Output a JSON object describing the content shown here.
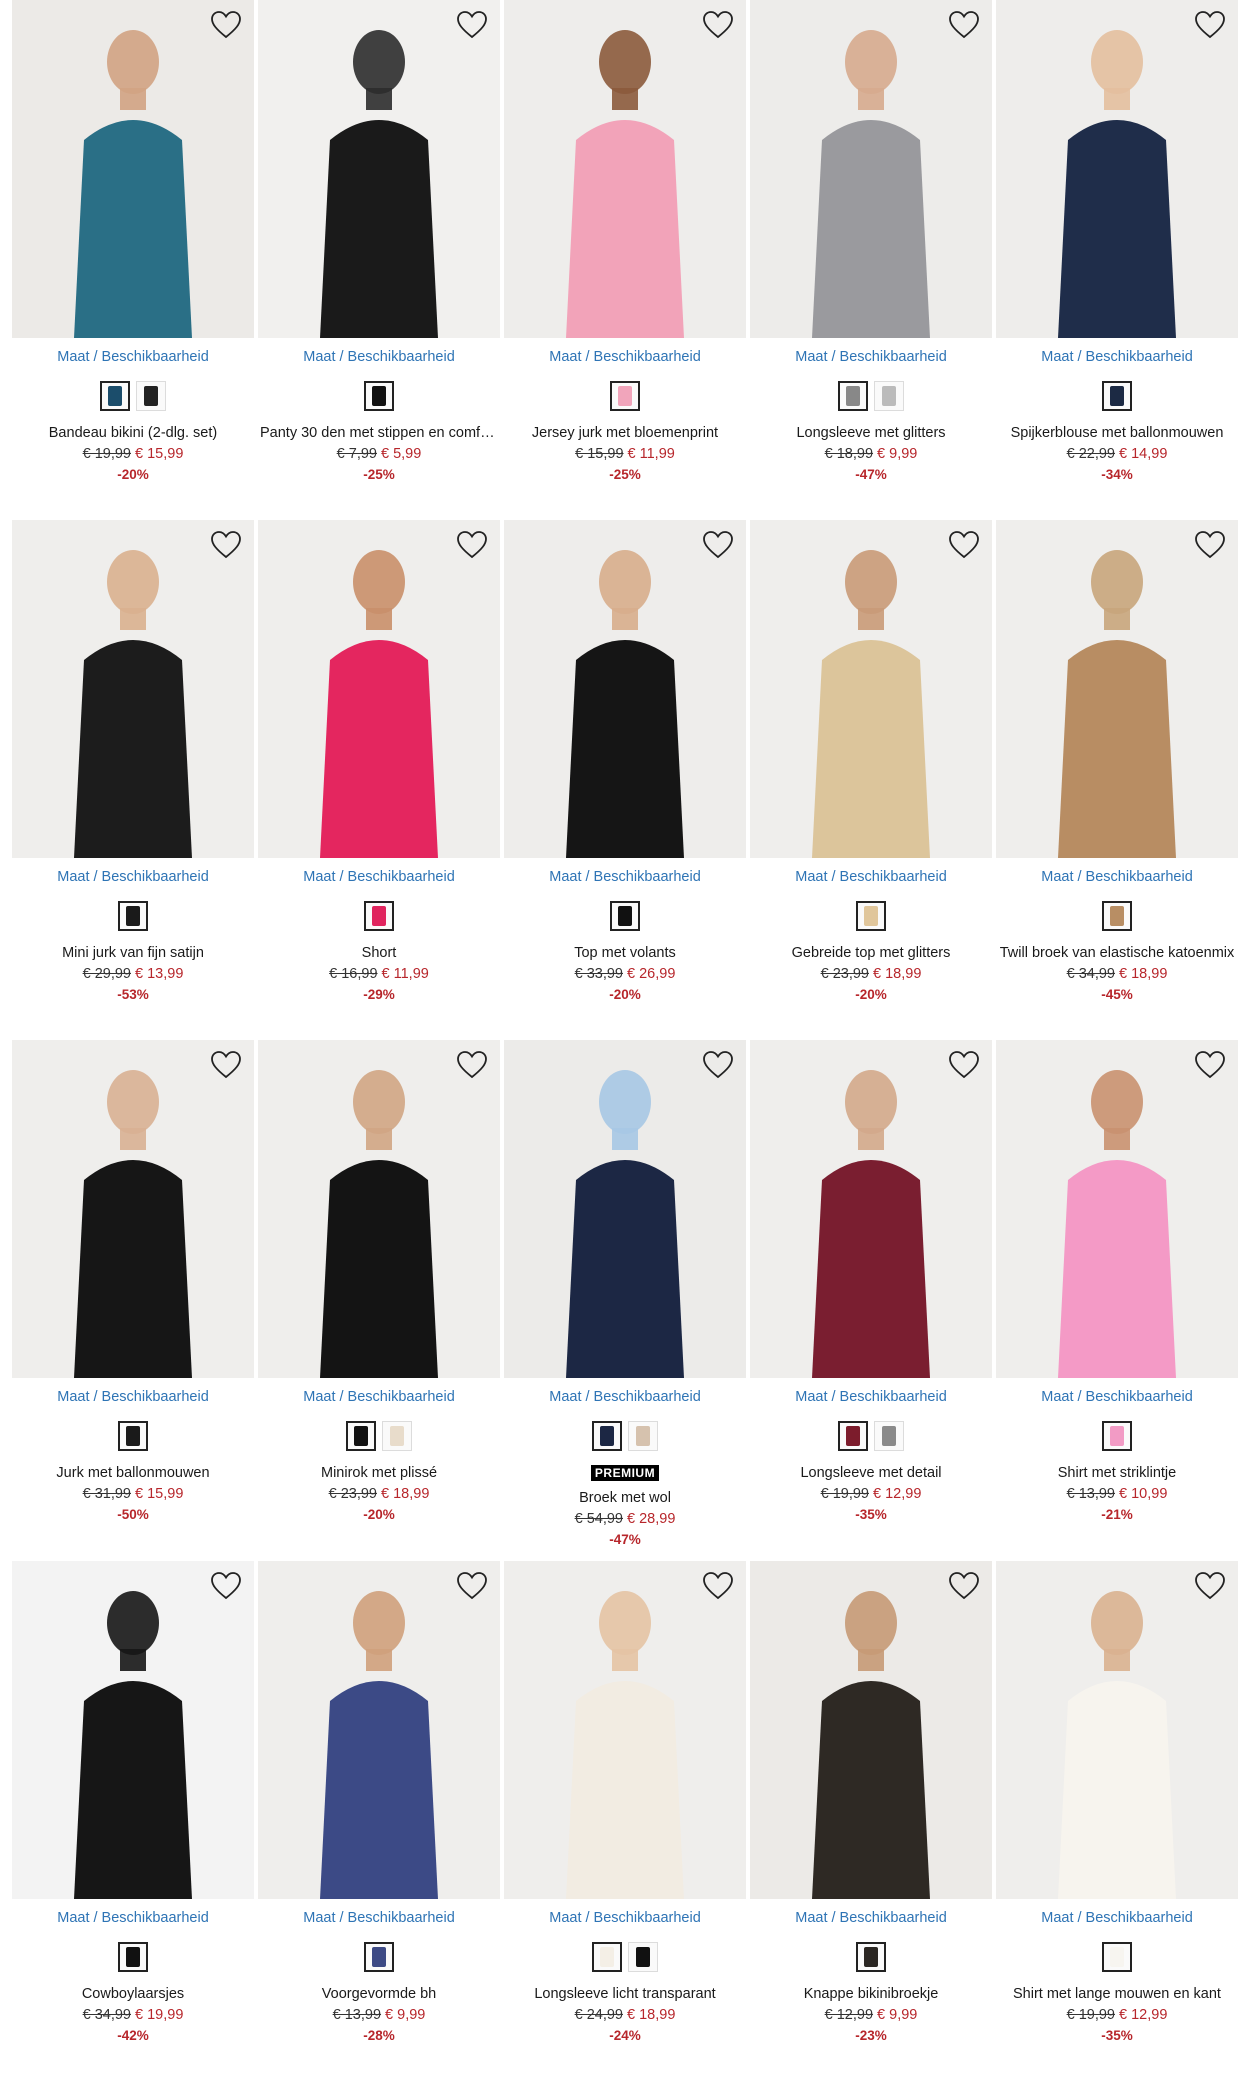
{
  "size_label": "Maat / Beschikbaarheid",
  "premium_label": "PREMIUM",
  "colors": {
    "sale": "#b7262b",
    "link": "#2e74b5"
  },
  "rows": [
    {
      "products": [
        {
          "name": "Bandeau bikini (2-dlg. set)",
          "old_price": "€ 19,99",
          "new_price": "€ 15,99",
          "discount": "-20%",
          "swatches": [
            "#1b4d6b",
            "#222222"
          ],
          "bg": "#eceae7",
          "fig": "#2a6f86",
          "skin": "#d2a383"
        },
        {
          "name": "Panty 30 den met stippen en comfo…",
          "old_price": "€ 7,99",
          "new_price": "€ 5,99",
          "discount": "-25%",
          "swatches": [
            "#111111"
          ],
          "bg": "#f1f0ee",
          "fig": "#1a1a1a",
          "skin": "#2c2c2c"
        },
        {
          "name": "Jersey jurk met bloemenprint",
          "old_price": "€ 15,99",
          "new_price": "€ 11,99",
          "discount": "-25%",
          "swatches": [
            "#f1a5bb"
          ],
          "bg": "#eeedeb",
          "fig": "#f2a3b9",
          "skin": "#8b5a3c"
        },
        {
          "name": "Longsleeve met glitters",
          "old_price": "€ 18,99",
          "new_price": "€ 9,99",
          "discount": "-47%",
          "swatches": [
            "#888888",
            "#bbbbbb"
          ],
          "bg": "#edecea",
          "fig": "#9a9a9e",
          "skin": "#d6ab8e"
        },
        {
          "name": "Spijkerblouse met ballonmouwen",
          "old_price": "€ 22,99",
          "new_price": "€ 14,99",
          "discount": "-34%",
          "swatches": [
            "#1c2a44"
          ],
          "bg": "#eeedeb",
          "fig": "#1f2d4a",
          "skin": "#e3bf9f"
        }
      ]
    },
    {
      "products": [
        {
          "name": "Mini jurk van fijn satijn",
          "old_price": "€ 29,99",
          "new_price": "€ 13,99",
          "discount": "-53%",
          "swatches": [
            "#1a1a1a"
          ],
          "bg": "#efeeec",
          "fig": "#1c1c1c",
          "skin": "#d9b08f"
        },
        {
          "name": "Short",
          "old_price": "€ 16,99",
          "new_price": "€ 11,99",
          "discount": "-29%",
          "swatches": [
            "#e0245e"
          ],
          "bg": "#efeeec",
          "fig": "#e4265f",
          "skin": "#c98f6a"
        },
        {
          "name": "Top met volants",
          "old_price": "€ 33,99",
          "new_price": "€ 26,99",
          "discount": "-20%",
          "swatches": [
            "#111111"
          ],
          "bg": "#eeedeb",
          "fig": "#151515",
          "skin": "#d7ad8c"
        },
        {
          "name": "Gebreide top met glitters",
          "old_price": "€ 23,99",
          "new_price": "€ 18,99",
          "discount": "-20%",
          "swatches": [
            "#e0c69b"
          ],
          "bg": "#efeeec",
          "fig": "#dcc59b",
          "skin": "#c99a78"
        },
        {
          "name": "Twill broek van elastische katoenmix",
          "old_price": "€ 34,99",
          "new_price": "€ 18,99",
          "discount": "-45%",
          "swatches": [
            "#b88e64"
          ],
          "bg": "#efeeec",
          "fig": "#b88d63",
          "skin": "#c8a57c"
        }
      ]
    },
    {
      "products": [
        {
          "name": "Jurk met ballonmouwen",
          "old_price": "€ 31,99",
          "new_price": "€ 15,99",
          "discount": "-50%",
          "swatches": [
            "#1a1a1a"
          ],
          "bg": "#efeeec",
          "fig": "#161616",
          "skin": "#d8b093"
        },
        {
          "name": "Minirok met plissé",
          "old_price": "€ 23,99",
          "new_price": "€ 18,99",
          "discount": "-20%",
          "swatches": [
            "#111111",
            "#e8dccb"
          ],
          "bg": "#efeeec",
          "fig": "#141414",
          "skin": "#d0a584"
        },
        {
          "name": "Broek met wol",
          "old_price": "€ 54,99",
          "new_price": "€ 28,99",
          "discount": "-47%",
          "swatches": [
            "#1c2744",
            "#d6c2ae"
          ],
          "premium": true,
          "bg": "#ecebe9",
          "fig": "#1c2744",
          "skin": "#a7c8e4"
        },
        {
          "name": "Longsleeve met detail",
          "old_price": "€ 19,99",
          "new_price": "€ 12,99",
          "discount": "-35%",
          "swatches": [
            "#7c1c2c",
            "#8a8a8a"
          ],
          "bg": "#efeeec",
          "fig": "#7a1e30",
          "skin": "#d3a98b"
        },
        {
          "name": "Shirt met striklintje",
          "old_price": "€ 13,99",
          "new_price": "€ 10,99",
          "discount": "-21%",
          "swatches": [
            "#f29bc5"
          ],
          "bg": "#efeeec",
          "fig": "#f49ac6",
          "skin": "#c99170"
        }
      ]
    },
    {
      "products": [
        {
          "name": "Cowboylaarsjes",
          "old_price": "€ 34,99",
          "new_price": "€ 19,99",
          "discount": "-42%",
          "swatches": [
            "#111111"
          ],
          "bg": "#f3f3f3",
          "fig": "#161616",
          "skin": "#161616"
        },
        {
          "name": "Voorgevormde bh",
          "old_price": "€ 13,99",
          "new_price": "€ 9,99",
          "discount": "-28%",
          "swatches": [
            "#3d4a85"
          ],
          "bg": "#efeeec",
          "fig": "#3c4a86",
          "skin": "#cfa07c"
        },
        {
          "name": "Longsleeve licht transparant",
          "old_price": "€ 24,99",
          "new_price": "€ 18,99",
          "discount": "-24%",
          "swatches": [
            "#f4efe6",
            "#111111"
          ],
          "bg": "#efeeec",
          "fig": "#f2ece2",
          "skin": "#e4c3a4"
        },
        {
          "name": "Knappe bikinibroekje",
          "old_price": "€ 12,99",
          "new_price": "€ 9,99",
          "discount": "-23%",
          "swatches": [
            "#2a2622"
          ],
          "bg": "#eceae7",
          "fig": "#2e2924",
          "skin": "#c79a76"
        },
        {
          "name": "Shirt met lange mouwen en kant",
          "old_price": "€ 19,99",
          "new_price": "€ 12,99",
          "discount": "-35%",
          "swatches": [
            "#f7f5f0"
          ],
          "bg": "#efeeec",
          "fig": "#f7f4ee",
          "skin": "#d9b190"
        }
      ]
    }
  ]
}
